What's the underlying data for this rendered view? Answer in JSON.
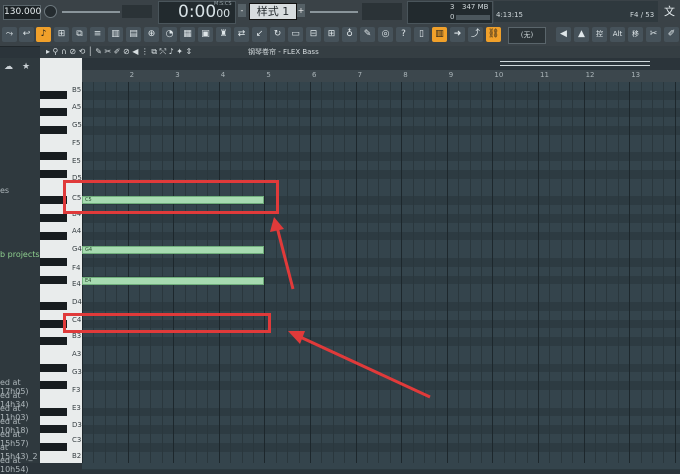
{
  "transport": {
    "tempo": "130.000",
    "time": "0:00",
    "time_frac": "00",
    "time_unit": "M:S:CS",
    "pattern": "样式 1",
    "pattern_minus": "-",
    "pattern_plus": "+"
  },
  "monitor": {
    "cpu": "3",
    "mem": "347 MB",
    "poly": "0",
    "time": "4:13:15",
    "position": "F4 / 53"
  },
  "corner_label": "文",
  "toolbar": {
    "snap_label": "(无)",
    "alt_label": "Alt",
    "move_label": "移",
    "extra_label": "控"
  },
  "pianoroll": {
    "title": "钢琴卷帘 - FLEX Bass",
    "key_labels": [
      "B5",
      "A5",
      "G5",
      "F5",
      "E5",
      "D5",
      "C5",
      "B4",
      "A4",
      "G4",
      "F4",
      "E4",
      "D4",
      "C4",
      "B3",
      "A3",
      "G3",
      "F3",
      "E3",
      "D3",
      "C3",
      "B2"
    ],
    "ruler": [
      "2",
      "3",
      "4",
      "5",
      "6",
      "7",
      "8",
      "9",
      "10",
      "11",
      "12",
      "13"
    ],
    "notes": [
      {
        "label": "C5"
      },
      {
        "label": "G4"
      },
      {
        "label": "E4"
      }
    ]
  },
  "sidebar": {
    "items": [
      "es",
      "b projects"
    ],
    "recent": [
      "ed at 17h05)",
      "ed at 14h34)",
      "ed at 11h03)",
      "ed at 10h18)",
      "ed at 15h57)",
      "at 15h43)_2",
      "ed at 10h54)"
    ]
  },
  "colors": {
    "note_fill": "#a7dbb1",
    "highlight": "#e03a3a",
    "accent_orange": "#f0a02a"
  }
}
